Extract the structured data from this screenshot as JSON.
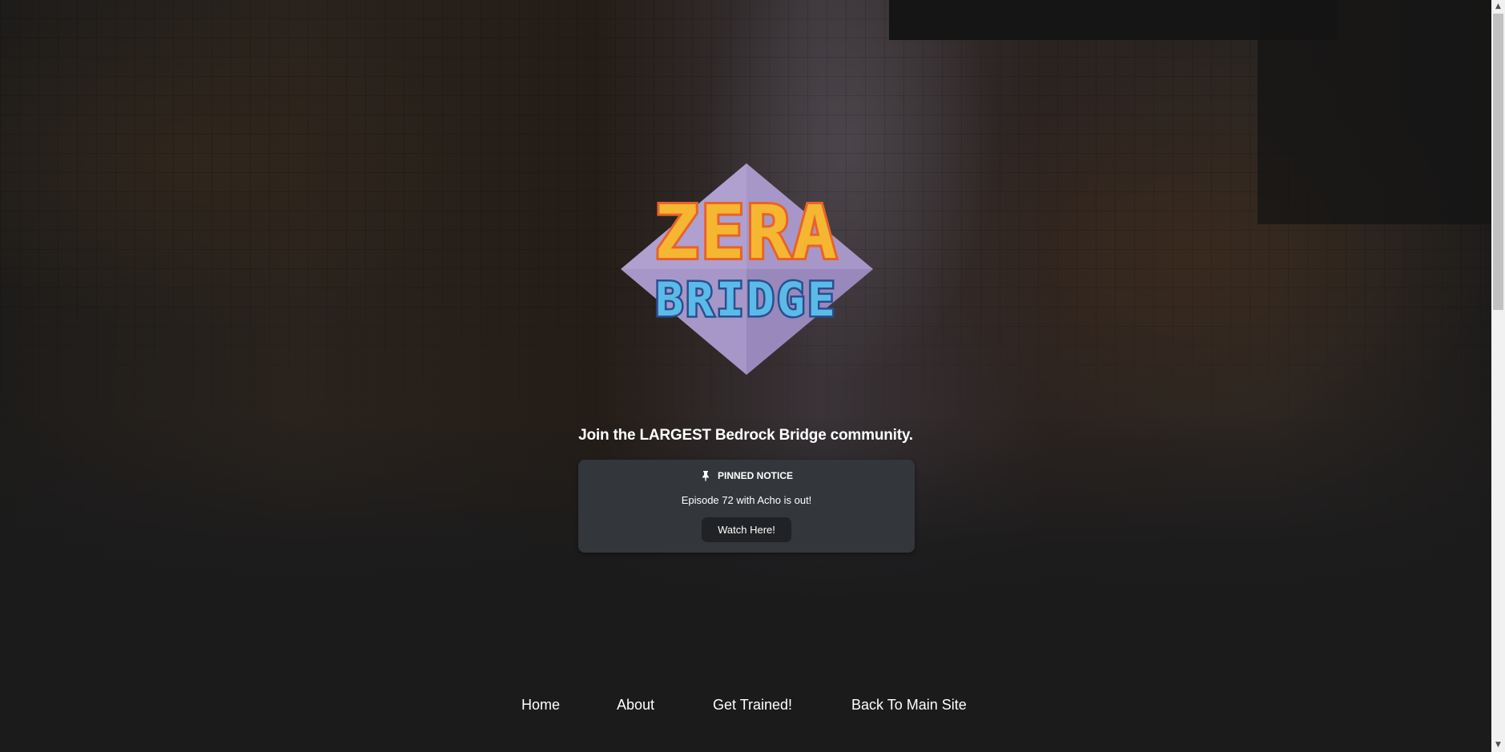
{
  "logo": {
    "line1": "ZERA",
    "line2": "BRIDGE",
    "colors": {
      "diamond": "#a797c8",
      "line1_fill": "#f5b632",
      "line1_outline": "#e9622a",
      "line2_fill": "#5bbbe8",
      "line2_outline": "#2a4f8f"
    }
  },
  "tagline": "Join the LARGEST Bedrock Bridge community.",
  "notice": {
    "icon": "pin-icon",
    "title": "PINNED NOTICE",
    "message": "Episode 72 with Acho is out!",
    "button_label": "Watch Here!"
  },
  "nav": {
    "items": [
      {
        "label": "Home"
      },
      {
        "label": "About"
      },
      {
        "label": "Get Trained!"
      },
      {
        "label": "Back To Main Site"
      }
    ]
  },
  "scrollbar": {
    "up_icon": "chevron-up-icon",
    "down_icon": "chevron-down-icon"
  },
  "colors": {
    "page_bg": "#1b1b1c",
    "notice_bg": "#33363a",
    "button_bg": "#202225",
    "text": "#ffffff"
  }
}
